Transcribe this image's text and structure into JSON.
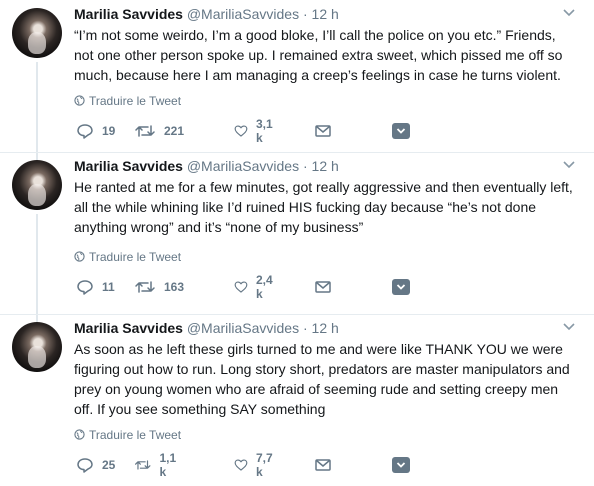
{
  "tweets": [
    {
      "author": {
        "name": "Marilia Savvides",
        "handle": "@MariliaSavvides"
      },
      "separator": "·",
      "time": "12 h",
      "text": "“I’m not some weirdo, I’m a good bloke, I’ll call the police on you etc.” Friends, not one other person spoke up. I remained extra sweet, which pissed me off so much, because here I am managing a creep’s feelings in case he turns violent.",
      "translate_label": "Traduire le Tweet",
      "replies": "19",
      "retweets": "221",
      "likes": "3,1 k"
    },
    {
      "author": {
        "name": "Marilia Savvides",
        "handle": "@MariliaSavvides"
      },
      "separator": "·",
      "time": "12 h",
      "text": "He ranted at me for a few minutes, got really aggressive and then eventually left, all the while whining like I’d ruined HIS fucking day because “he’s not done anything wrong” and it’s “none of my business”",
      "translate_label": "Traduire le Tweet",
      "replies": "11",
      "retweets": "163",
      "likes": "2,4 k"
    },
    {
      "author": {
        "name": "Marilia Savvides",
        "handle": "@MariliaSavvides"
      },
      "separator": "·",
      "time": "12 h",
      "text": "As soon as he left these girls turned to me and were like THANK YOU we were figuring out how to run. Long story short, predators are master manipulators and prey on young women who are afraid of seeming rude and setting creepy men off. If you see something SAY something",
      "translate_label": "Traduire le Tweet",
      "replies": "25",
      "retweets": "1,1 k",
      "likes": "7,7 k"
    }
  ],
  "icons": {
    "reply": "reply-icon",
    "retweet": "retweet-icon",
    "like": "heart-icon",
    "dm": "envelope-icon",
    "extension": "extension-icon",
    "translate": "globe-icon",
    "menu": "chevron-down-icon"
  },
  "colors": {
    "text": "#14171a",
    "secondary": "#657786",
    "divider": "#e6ecf0"
  }
}
